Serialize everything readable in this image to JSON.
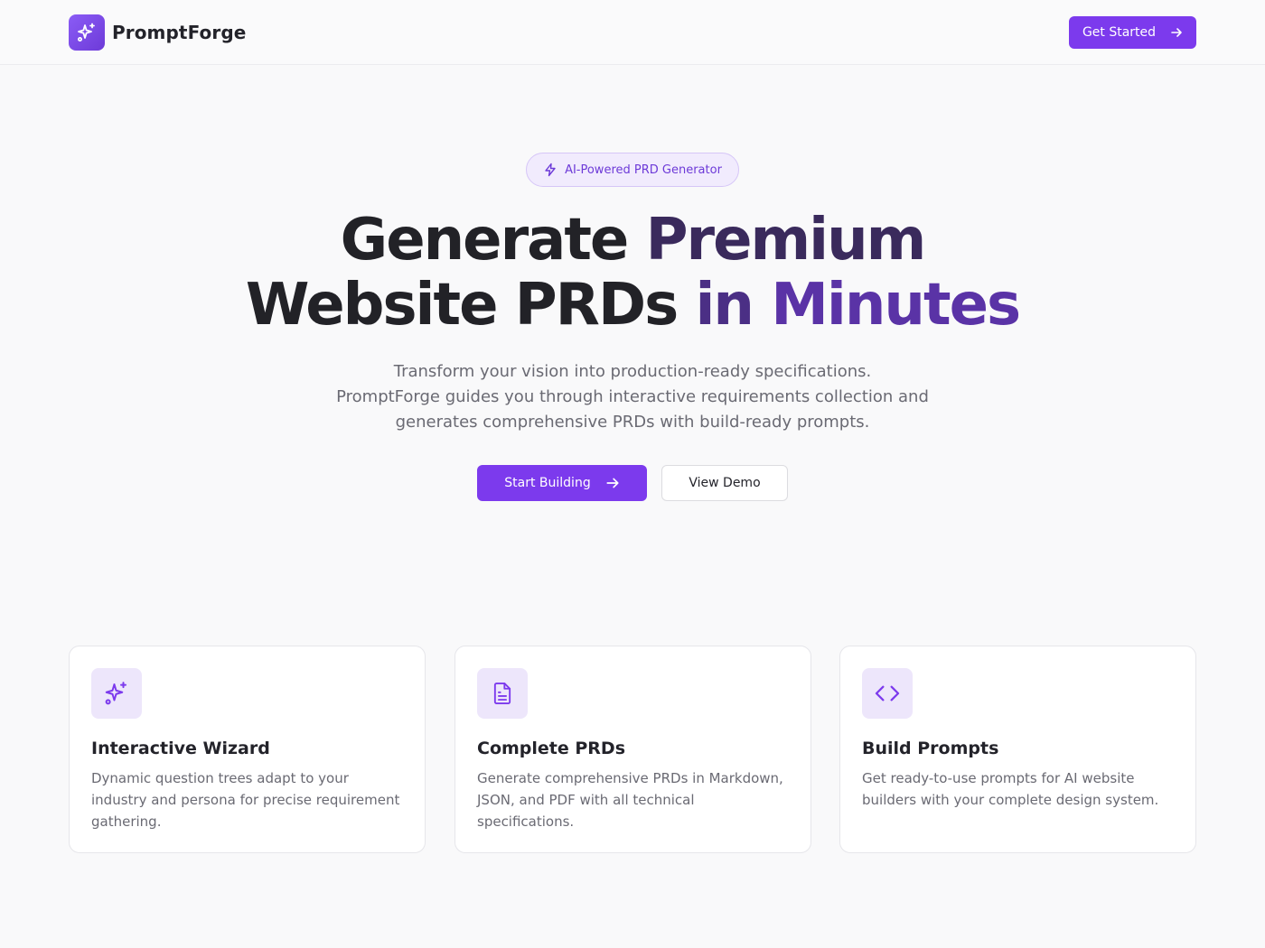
{
  "brand": {
    "name": "PromptForge",
    "logo_icon": "sparkles-icon"
  },
  "header": {
    "cta_label": "Get Started"
  },
  "hero": {
    "badge": "AI-Powered PRD Generator",
    "title_line1_a": "Generate ",
    "title_line1_b": "Premium",
    "title_line2_a": "Website PRDs ",
    "title_line2_b": "in ",
    "title_line2_c": "Minutes",
    "subtitle_line1": "Transform your vision into production-ready specifications.",
    "subtitle_line2": "PromptForge guides you through interactive requirements collection and",
    "subtitle_line3": "generates comprehensive PRDs with build-ready prompts.",
    "primary_cta": "Start Building",
    "secondary_cta": "View Demo"
  },
  "features": [
    {
      "icon": "sparkles-icon",
      "title": "Interactive Wizard",
      "description": "Dynamic question trees adapt to your industry and persona for precise requirement gathering."
    },
    {
      "icon": "document-icon",
      "title": "Complete PRDs",
      "description": "Generate comprehensive PRDs in Markdown, JSON, and PDF with all technical specifications."
    },
    {
      "icon": "code-icon",
      "title": "Build Prompts",
      "description": "Get ready-to-use prompts for AI website builders with your complete design system."
    }
  ],
  "colors": {
    "accent": "#7c3aed",
    "badge_bg": "#f1ebfd",
    "icon_tile_bg": "#ede6fb",
    "background": "#f9f9fa"
  }
}
